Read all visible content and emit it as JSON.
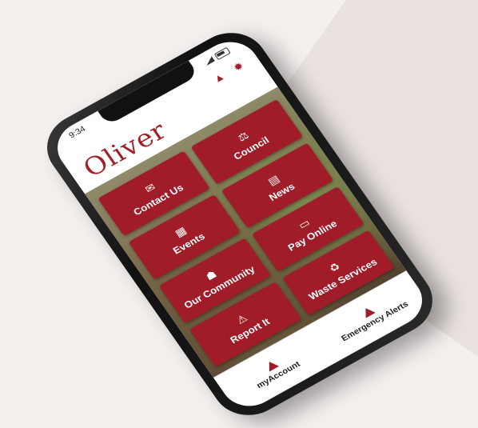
{
  "status": {
    "time": "9:34"
  },
  "header": {
    "logo": "Oliver",
    "alert_icon": "alert-icon",
    "settings_icon": "gear-icon"
  },
  "tiles": [
    {
      "label": "Contact Us",
      "icon": "envelope-icon",
      "glyph": "✉"
    },
    {
      "label": "Council",
      "icon": "gavel-icon",
      "glyph": "⚖"
    },
    {
      "label": "Events",
      "icon": "calendar-icon",
      "glyph": "▦"
    },
    {
      "label": "News",
      "icon": "newspaper-icon",
      "glyph": "▤"
    },
    {
      "label": "Our Community",
      "icon": "people-icon",
      "glyph": "☗"
    },
    {
      "label": "Pay Online",
      "icon": "credit-card-icon",
      "glyph": "▭"
    },
    {
      "label": "Report It",
      "icon": "report-icon",
      "glyph": "⚠"
    },
    {
      "label": "Waste Services",
      "icon": "recycle-icon",
      "glyph": "♻"
    }
  ],
  "bottom_nav": {
    "account_label": "myAccount",
    "alerts_label": "Emergency Alerts"
  },
  "colors": {
    "brand": "#a01c28"
  }
}
